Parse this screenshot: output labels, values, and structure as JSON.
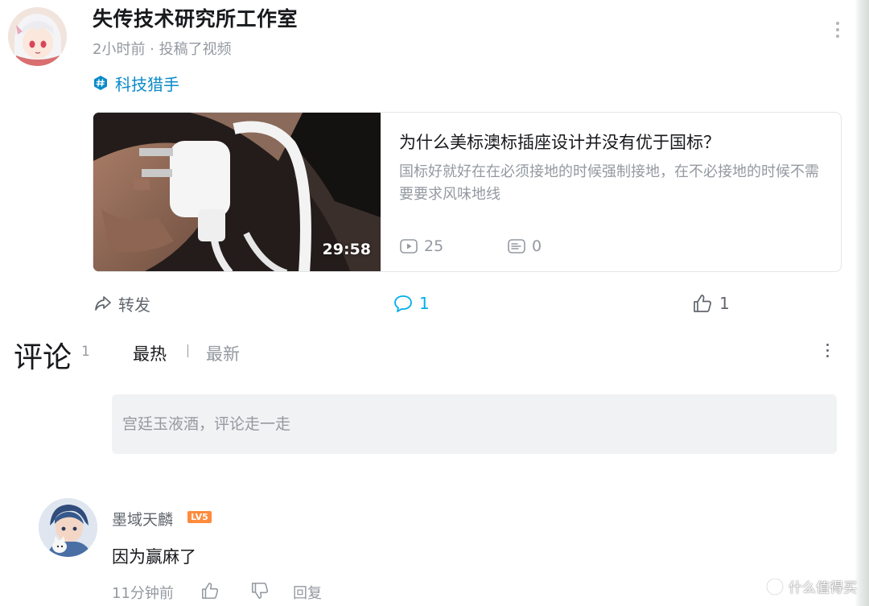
{
  "post": {
    "author": "失传技术研究所工作室",
    "meta": "2小时前 · 投稿了视频",
    "topic": "科技猎手"
  },
  "video": {
    "duration": "29:58",
    "title": "为什么美标澳标插座设计并没有优于国标？",
    "description": "国标好就好在在必须接地的时候强制接地，在不必接地的时候不需要要求风味地线",
    "views": "25",
    "danmaku": "0"
  },
  "actions": {
    "forward": "转发",
    "comments": "1",
    "likes": "1"
  },
  "comments_section": {
    "title": "评论",
    "count": "1",
    "sort_hot": "最热",
    "sort_new": "最新",
    "input_placeholder": "宫廷玉液酒，评论走一走"
  },
  "comment": {
    "user": "墨域天麟",
    "level": "LV5",
    "text": "因为赢麻了",
    "time": "11分钟前",
    "reply": "回复"
  },
  "watermark": "什么值得买",
  "colors": {
    "accent": "#00aeec",
    "topic": "#0a8bc9",
    "level_badge": "#ff8b3d"
  }
}
